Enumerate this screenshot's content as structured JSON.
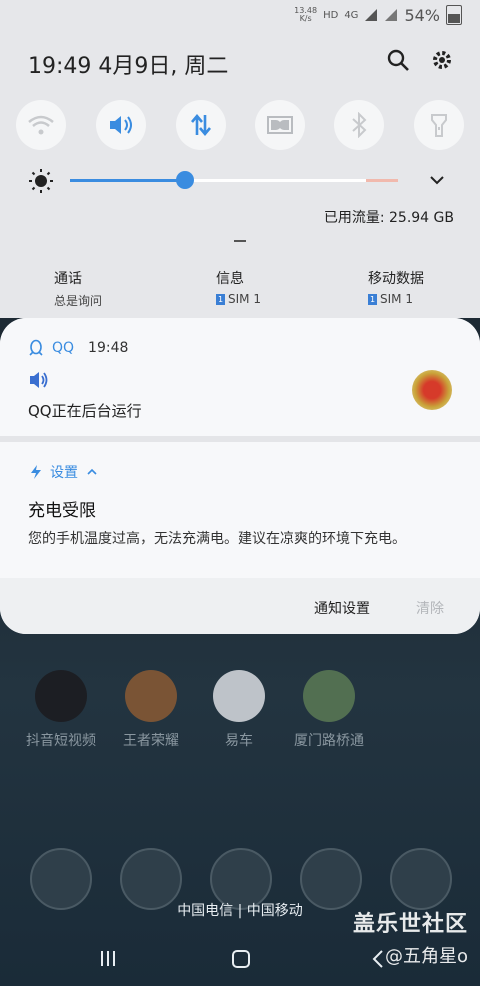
{
  "status_bar": {
    "speed_value": "13.48",
    "speed_unit": "K/s",
    "hd": "HD",
    "net": "4G",
    "battery": "54%"
  },
  "header": {
    "time_date": "19:49  4月9日, 周二"
  },
  "quick_settings": {
    "tiles": [
      "wifi-icon",
      "volume-icon",
      "mobile-data-icon",
      "dolby-icon",
      "bluetooth-icon",
      "flashlight-icon"
    ]
  },
  "brightness": {
    "level": 0.35
  },
  "data_usage": "已用流量: 25.94 GB",
  "sims": [
    {
      "title": "通话",
      "sub": "总是询问",
      "tag": ""
    },
    {
      "title": "信息",
      "sub": "SIM 1",
      "tag": "1"
    },
    {
      "title": "移动数据",
      "sub": "SIM 1",
      "tag": "1"
    }
  ],
  "qq_notification": {
    "app": "QQ",
    "time": "19:48",
    "body": "QQ正在后台运行"
  },
  "settings_notification": {
    "app": "设置",
    "title": "充电受限",
    "body": "您的手机温度过高，无法充满电。建议在凉爽的环境下充电。"
  },
  "notification_actions": {
    "settings": "通知设置",
    "clear": "清除"
  },
  "home_apps": [
    "抖音短视频",
    "王者荣耀",
    "易车",
    "厦门路桥通"
  ],
  "carrier": "中国电信 | 中国移动",
  "watermark": {
    "line1": "盖乐世社区",
    "line2": "@五角星o"
  },
  "colors": {
    "accent": "#3a8ce0",
    "panel": "#e6e7ea",
    "card": "#f7f8fa"
  }
}
